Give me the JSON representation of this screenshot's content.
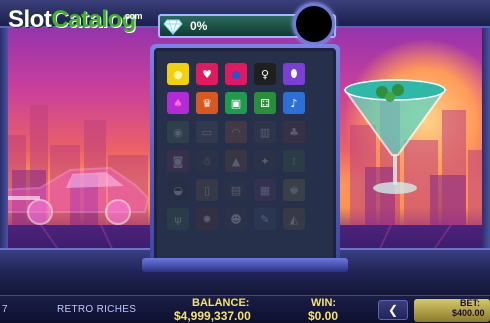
{
  "brand": {
    "logo_part1": "Slot",
    "logo_part2": "Catalog",
    "logo_suffix": ".com"
  },
  "progress": {
    "percent_text": "0%",
    "value": 0
  },
  "grid": {
    "rows": [
      [
        {
          "icon": "sun-icon",
          "glyph": "●",
          "color": "#f3d10a",
          "fg": "#fff3a6",
          "active": true
        },
        {
          "icon": "heart-icon",
          "glyph": "♥",
          "color": "#e2195f",
          "fg": "#ffffff",
          "active": true
        },
        {
          "icon": "bomb-icon",
          "glyph": "●",
          "color": "#e2195f",
          "fg": "#2a53d8",
          "active": true
        },
        {
          "icon": "microphone-icon",
          "glyph": "♀",
          "color": "#1f1f1f",
          "fg": "#ffffff",
          "active": true
        },
        {
          "icon": "football-icon",
          "glyph": "⬮",
          "color": "#7b3fd6",
          "fg": "#ffffff",
          "active": true
        }
      ],
      [
        {
          "icon": "flamingo-icon",
          "glyph": "♠",
          "color": "#b32bd6",
          "fg": "#ff6bd4",
          "active": true
        },
        {
          "icon": "trophy-icon",
          "glyph": "♛",
          "color": "#d8581f",
          "fg": "#ffffff",
          "active": true
        },
        {
          "icon": "cassette-icon",
          "glyph": "▣",
          "color": "#1e9c4b",
          "fg": "#ffffff",
          "active": true
        },
        {
          "icon": "dice-icon",
          "glyph": "⚃",
          "color": "#2a8f3a",
          "fg": "#ffffff",
          "active": true
        },
        {
          "icon": "music-note-icon",
          "glyph": "♪",
          "color": "#2c6fd6",
          "fg": "#ffffff",
          "active": true
        }
      ],
      [
        {
          "icon": "lips-icon",
          "glyph": "◉",
          "color": "#3f7f3f",
          "fg": "#ffffff",
          "active": false
        },
        {
          "icon": "cassette-tape-icon",
          "glyph": "▭",
          "color": "#5a5a5a",
          "fg": "#ffffff",
          "active": false
        },
        {
          "icon": "headphones-icon",
          "glyph": "◠",
          "color": "#b35a1f",
          "fg": "#ffffff",
          "active": false
        },
        {
          "icon": "slot-reel-icon",
          "glyph": "▥",
          "color": "#4a4a4a",
          "fg": "#ffffff",
          "active": false
        },
        {
          "icon": "cherry-icon",
          "glyph": "♣",
          "color": "#8a2b2b",
          "fg": "#ffffff",
          "active": false
        }
      ],
      [
        {
          "icon": "camera-icon",
          "glyph": "◙",
          "color": "#8a2b4a",
          "fg": "#ffffff",
          "active": false
        },
        {
          "icon": "robot-icon",
          "glyph": "☃",
          "color": "#3a3a3a",
          "fg": "#ffffff",
          "active": false
        },
        {
          "icon": "rocket-icon",
          "glyph": "▲",
          "color": "#8a4a1f",
          "fg": "#ffffff",
          "active": false
        },
        {
          "icon": "joystick-icon",
          "glyph": "✦",
          "color": "#3a3a3a",
          "fg": "#ffffff",
          "active": false
        },
        {
          "icon": "skate-icon",
          "glyph": "⁝",
          "color": "#2f6f2f",
          "fg": "#ffffff",
          "active": false
        }
      ],
      [
        {
          "icon": "sneaker-icon",
          "glyph": "◒",
          "color": "#2f2f2f",
          "fg": "#ffffff",
          "active": false
        },
        {
          "icon": "beer-mug-icon",
          "glyph": "▯",
          "color": "#7a5a2a",
          "fg": "#ffffff",
          "active": false
        },
        {
          "icon": "boombox-icon",
          "glyph": "▤",
          "color": "#3a3a3a",
          "fg": "#ffffff",
          "active": false
        },
        {
          "icon": "walkman-icon",
          "glyph": "▦",
          "color": "#6a2a7a",
          "fg": "#ffffff",
          "active": false
        },
        {
          "icon": "crown-icon",
          "glyph": "♚",
          "color": "#7a7a2a",
          "fg": "#ffffff",
          "active": false
        }
      ],
      [
        {
          "icon": "cactus-icon",
          "glyph": "ψ",
          "color": "#2f6f3a",
          "fg": "#ffffff",
          "active": false
        },
        {
          "icon": "star-burst-icon",
          "glyph": "✸",
          "color": "#7a2a2a",
          "fg": "#ffffff",
          "active": false
        },
        {
          "icon": "skull-icon",
          "glyph": "☻",
          "color": "#3a3a3a",
          "fg": "#ffffff",
          "active": false
        },
        {
          "icon": "pencil-icon",
          "glyph": "✎",
          "color": "#2f4f7a",
          "fg": "#ffffff",
          "active": false
        },
        {
          "icon": "bell-icon",
          "glyph": "◭",
          "color": "#7a5a1a",
          "fg": "#ffffff",
          "active": false
        }
      ]
    ]
  },
  "hud": {
    "line_number": "7",
    "game_title": "RETRO RICHES",
    "balance_label": "BALANCE:",
    "balance_value": "$4,999,337.00",
    "win_label": "WIN:",
    "win_value": "$0.00",
    "prev_button_glyph": "❮",
    "bet_label": "BET:",
    "bet_value": "$400.00"
  }
}
